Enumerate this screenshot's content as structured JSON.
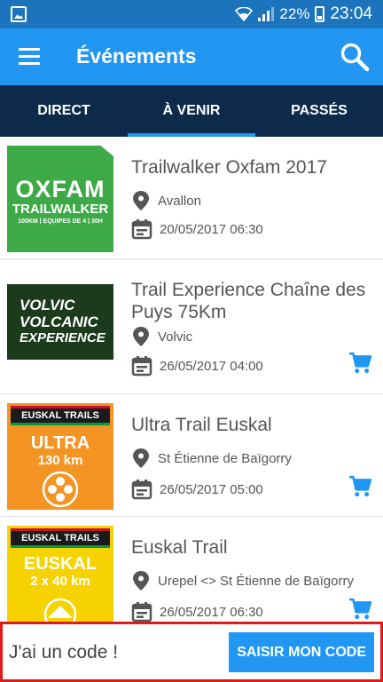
{
  "status_bar": {
    "battery": "22%",
    "time": "23:04"
  },
  "app_bar": {
    "title": "Événements"
  },
  "tabs": [
    {
      "label": "DIRECT",
      "active": false
    },
    {
      "label": "À VENIR",
      "active": true
    },
    {
      "label": "PASSÉS",
      "active": false
    }
  ],
  "events": [
    {
      "title": "Trailwalker Oxfam 2017",
      "location": "Avallon",
      "datetime": "20/05/2017 06:30",
      "has_cart": false,
      "logo": {
        "line1": "OXFAM",
        "line2": "TRAILWALKER",
        "line3": "100KM | EQUIPES DE 4 | 30H",
        "bg": "#3daa47"
      }
    },
    {
      "title": "Trail Experience Chaîne des Puys 75Km",
      "location": "Volvic",
      "datetime": "26/05/2017 04:00",
      "has_cart": true,
      "logo": {
        "line1": "VOLVIC",
        "line2": "VOLCANIC",
        "line3": "EXPERIENCE",
        "bg": "#1c3a1c"
      }
    },
    {
      "title": "Ultra Trail Euskal",
      "location": "St Étienne de Baïgorry",
      "datetime": "26/05/2017 05:00",
      "has_cart": true,
      "logo": {
        "brand": "EUSKAL TRAILS",
        "line1": "ULTRA",
        "line2": "130 km",
        "bg": "#f39423"
      }
    },
    {
      "title": "Euskal Trail",
      "location": "Urepel <> St Étienne de Baïgorry",
      "datetime": "26/05/2017 06:30",
      "has_cart": true,
      "logo": {
        "brand": "EUSKAL TRAILS",
        "line1": "EUSKAL",
        "line2": "2 x 40 km",
        "bg": "#f6d300"
      }
    }
  ],
  "bottom_bar": {
    "label": "J'ai un code !",
    "button": "SAISIR MON CODE"
  },
  "colors": {
    "primary": "#2196f3",
    "status_bar": "#1c75bc",
    "tabs_bg": "#0d2a4a",
    "highlight_border": "#e01b1b"
  }
}
